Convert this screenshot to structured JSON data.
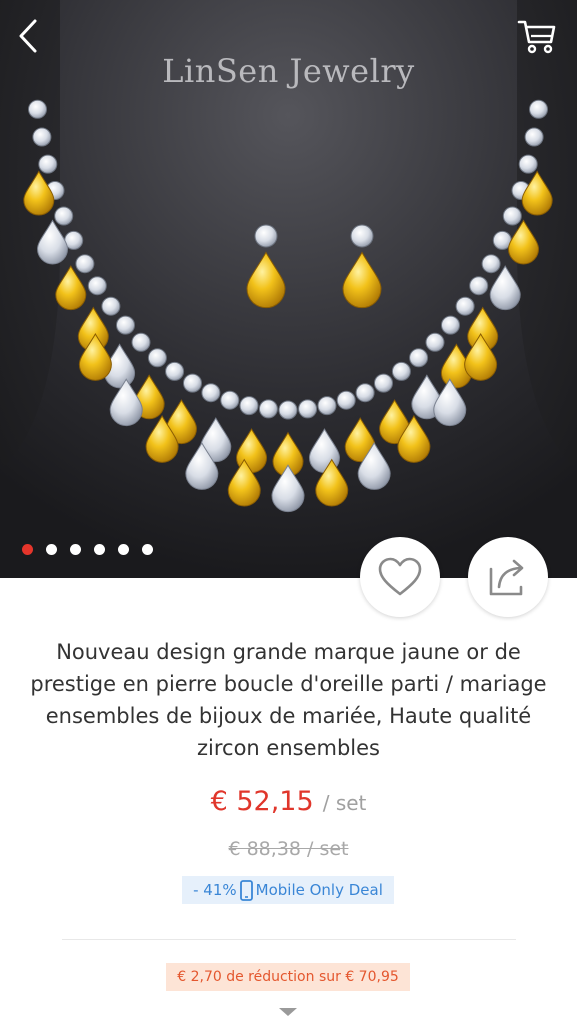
{
  "header": {
    "brand": "LinSen Jewelry",
    "back_icon": "chevron-left-icon",
    "cart_icon": "shopping-cart-icon"
  },
  "gallery": {
    "image_count": 6,
    "active_index": 0,
    "accent_color": "#e5352b"
  },
  "actions": {
    "wishlist_icon": "heart-icon",
    "share_icon": "share-icon"
  },
  "product": {
    "title": "Nouveau design grande marque jaune or de prestige en pierre boucle d'oreille parti / mariage ensembles de bijoux de mariée, Haute qualité zircon ensembles",
    "price": "€ 52,15",
    "price_unit": "/ set",
    "old_price": "€ 88,38  / set",
    "discount": "- 41%",
    "deal_label": "Mobile Only Deal",
    "deal_icon": "mobile-phone-icon",
    "coupon": "€ 2,70 de réduction sur € 70,95",
    "more_icon": "triangle-down-icon"
  },
  "colors": {
    "price": "#e0362b",
    "deal_text": "#3a86d6",
    "deal_bg": "#e6f0fb",
    "coupon_text": "#e4572e",
    "coupon_bg": "#fde4d6"
  }
}
